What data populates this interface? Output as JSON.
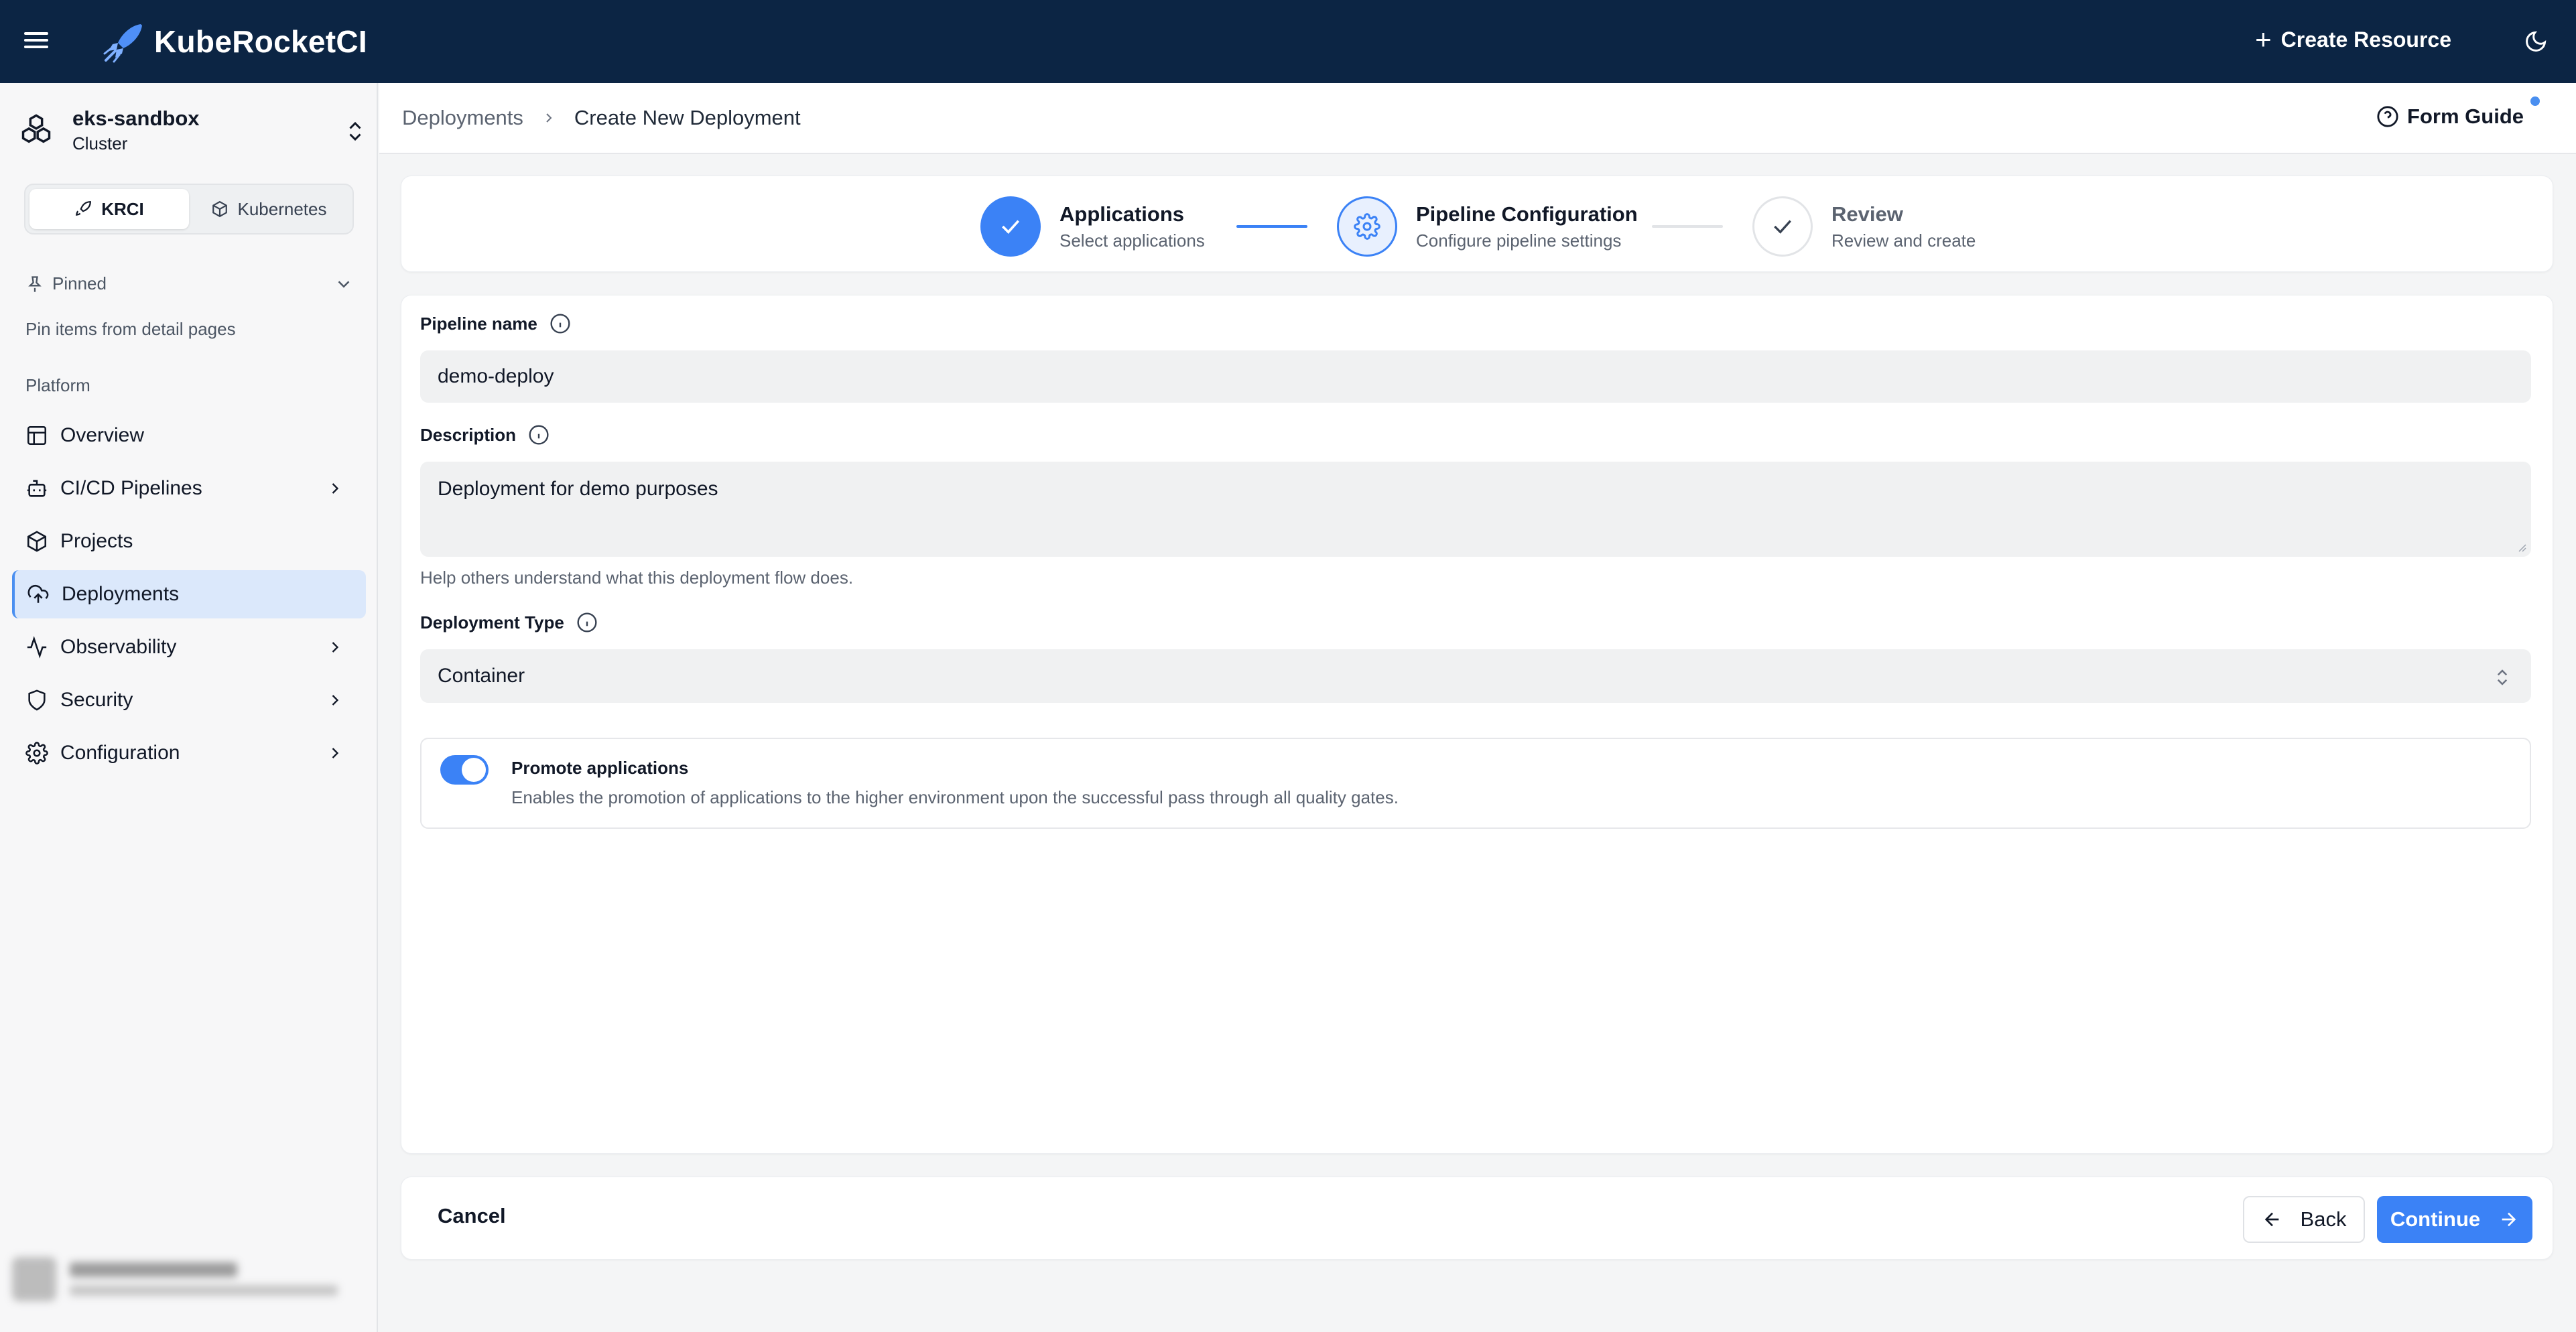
{
  "app": {
    "name": "KubeRocketCI",
    "create_resource_label": "Create Resource"
  },
  "sidebar": {
    "cluster": {
      "name": "eks-sandbox",
      "type": "Cluster"
    },
    "segments": [
      {
        "label": "KRCI",
        "icon": "rocket-icon",
        "active": true
      },
      {
        "label": "Kubernetes",
        "icon": "cube-icon",
        "active": false
      }
    ],
    "pinned": {
      "label": "Pinned",
      "hint": "Pin items from detail pages"
    },
    "section_title": "Platform",
    "items": [
      {
        "label": "Overview",
        "icon": "layout-icon",
        "has_children": false,
        "active": false
      },
      {
        "label": "CI/CD Pipelines",
        "icon": "bot-icon",
        "has_children": true,
        "active": false
      },
      {
        "label": "Projects",
        "icon": "box-icon",
        "has_children": false,
        "active": false
      },
      {
        "label": "Deployments",
        "icon": "cloud-upload-icon",
        "has_children": false,
        "active": true
      },
      {
        "label": "Observability",
        "icon": "activity-icon",
        "has_children": true,
        "active": false
      },
      {
        "label": "Security",
        "icon": "shield-icon",
        "has_children": true,
        "active": false
      },
      {
        "label": "Configuration",
        "icon": "gear-icon",
        "has_children": true,
        "active": false
      }
    ]
  },
  "breadcrumb": {
    "parent": "Deployments",
    "current": "Create New Deployment"
  },
  "form_guide_label": "Form Guide",
  "stepper": {
    "steps": [
      {
        "title": "Applications",
        "subtitle": "Select applications",
        "state": "completed"
      },
      {
        "title": "Pipeline Configuration",
        "subtitle": "Configure pipeline settings",
        "state": "active"
      },
      {
        "title": "Review",
        "subtitle": "Review and create",
        "state": "upcoming"
      }
    ]
  },
  "form": {
    "pipeline_name": {
      "label": "Pipeline name",
      "value": "demo-deploy"
    },
    "description": {
      "label": "Description",
      "value": "Deployment for demo purposes",
      "help": "Help others understand what this deployment flow does."
    },
    "deployment_type": {
      "label": "Deployment Type",
      "value": "Container"
    },
    "promote": {
      "title": "Promote applications",
      "description": "Enables the promotion of applications to the higher environment upon the successful pass through all quality gates.",
      "enabled": true
    }
  },
  "footer": {
    "cancel_label": "Cancel",
    "back_label": "Back",
    "continue_label": "Continue"
  },
  "colors": {
    "topbar": "#0c2544",
    "accent": "#3b82f6",
    "active_nav_bg": "#dbe8fb"
  }
}
